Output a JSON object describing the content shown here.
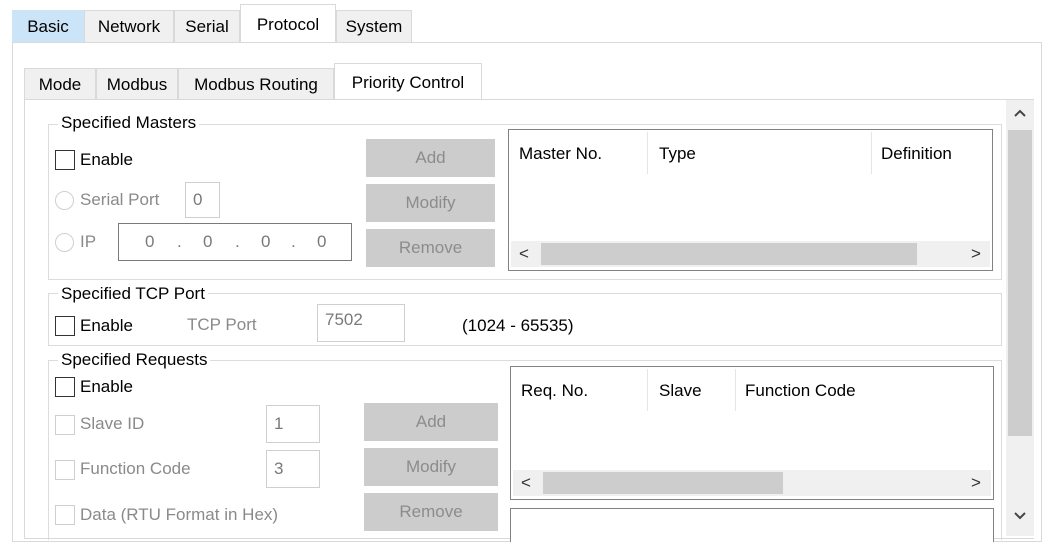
{
  "main_tabs": [
    {
      "label": "Basic"
    },
    {
      "label": "Network"
    },
    {
      "label": "Serial"
    },
    {
      "label": "Protocol"
    },
    {
      "label": "System"
    }
  ],
  "sub_tabs": [
    {
      "label": "Mode"
    },
    {
      "label": "Modbus"
    },
    {
      "label": "Modbus Routing"
    },
    {
      "label": "Priority Control"
    }
  ],
  "specified_masters": {
    "title": "Specified Masters",
    "enable_label": "Enable",
    "serial_port_label": "Serial Port",
    "serial_port_value": "0",
    "ip_label": "IP",
    "ip_octets": [
      "0",
      "0",
      "0",
      "0"
    ],
    "ip_sep": ".",
    "buttons": {
      "add": "Add",
      "modify": "Modify",
      "remove": "Remove"
    },
    "columns": [
      "Master No.",
      "Type",
      "Definition"
    ]
  },
  "specified_tcp_port": {
    "title": "Specified TCP Port",
    "enable_label": "Enable",
    "tcp_port_label": "TCP Port",
    "tcp_port_value": "7502",
    "range": "(1024 - 65535)"
  },
  "specified_requests": {
    "title": "Specified Requests",
    "enable_label": "Enable",
    "slave_id_label": "Slave ID",
    "slave_id_value": "1",
    "function_code_label": "Function Code",
    "function_code_value": "3",
    "data_label": "Data (RTU Format in Hex)",
    "buttons": {
      "add": "Add",
      "modify": "Modify",
      "remove": "Remove"
    },
    "columns": [
      "Req. No.",
      "Slave",
      "Function Code"
    ]
  },
  "scroll": {
    "left": "<",
    "right": ">",
    "up": "^",
    "down": "v"
  }
}
